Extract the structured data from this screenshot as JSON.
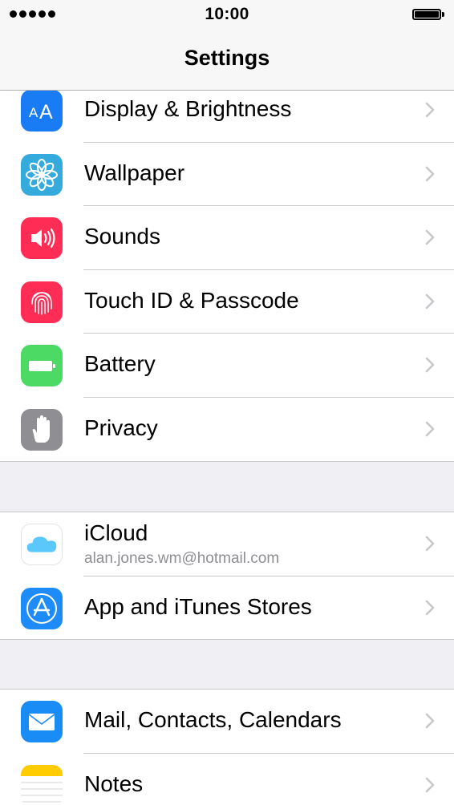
{
  "status_bar": {
    "time": "10:00"
  },
  "nav": {
    "title": "Settings"
  },
  "groups": [
    {
      "items": [
        {
          "label": "Display & Brightness",
          "icon": "display-brightness-icon",
          "color": "#1a7cf5"
        },
        {
          "label": "Wallpaper",
          "icon": "wallpaper-flower-icon",
          "color": "#35aadc"
        },
        {
          "label": "Sounds",
          "icon": "speaker-icon",
          "color": "#ff2d55"
        },
        {
          "label": "Touch ID & Passcode",
          "icon": "fingerprint-icon",
          "color": "#ff2d55"
        },
        {
          "label": "Battery",
          "icon": "battery-icon",
          "color": "#4cd964"
        },
        {
          "label": "Privacy",
          "icon": "hand-icon",
          "color": "#8e8e93"
        }
      ]
    },
    {
      "items": [
        {
          "label": "iCloud",
          "sublabel": "alan.jones.wm@hotmail.com",
          "icon": "icloud-icon",
          "color": "#ffffff"
        },
        {
          "label": "App and iTunes Stores",
          "icon": "app-store-icon",
          "color": "#1d8cf8"
        }
      ]
    },
    {
      "items": [
        {
          "label": "Mail, Contacts, Calendars",
          "icon": "mail-envelope-icon",
          "color": "#1a8cf5"
        },
        {
          "label": "Notes",
          "icon": "notes-icon",
          "color": "#ffcc00"
        }
      ]
    }
  ]
}
